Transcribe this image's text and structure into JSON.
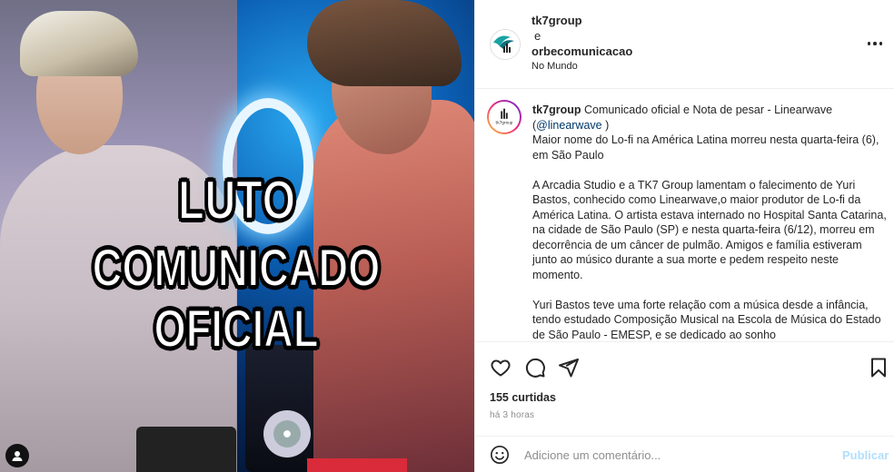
{
  "media": {
    "overlay_line1": "LUTO",
    "overlay_line2": "COMUNICADO OFICIAL"
  },
  "header": {
    "account1": "tk7group",
    "conjunction": "e",
    "account2": "orbecomunicacao",
    "location": "No Mundo",
    "more_icon": "more-horizontal-icon"
  },
  "caption": {
    "username": "tk7group",
    "title": "Comunicado oficial e Nota de pesar - Linearwave",
    "mention_open": "(",
    "mention": "@linearwave",
    "mention_close": " )",
    "line_headline": "Maior nome do Lo-fi na América Latina morreu nesta quarta-feira (6), em São Paulo",
    "paragraph1": "A Arcadia Studio e a TK7 Group lamentam o falecimento de Yuri Bastos, conhecido como Linearwave,o maior produtor de Lo-fi da América Latina. O artista estava internado no Hospital Santa Catarina, na cidade de São Paulo (SP) e nesta quarta-feira (6/12), morreu em decorrência de um câncer de pulmão. Amigos e família estiveram junto ao músico durante a sua morte e pedem respeito neste momento.",
    "paragraph2": "Yuri Bastos teve uma forte relação com a música desde a infância, tendo estudado Composição Musical na Escola de Música do Estado de São Paulo - EMESP, e se dedicado ao sonho"
  },
  "actions": {
    "like_icon": "heart-icon",
    "comment_icon": "comment-icon",
    "share_icon": "share-icon",
    "save_icon": "bookmark-icon",
    "likes": "155 curtidas",
    "time": "há 3 horas"
  },
  "comment": {
    "placeholder": "Adicione um comentário...",
    "post_label": "Publicar",
    "emoji_icon": "emoji-icon"
  },
  "colors": {
    "mention": "#00376b",
    "post_disabled": "#b2dffc",
    "muted": "#8e8e8e"
  }
}
